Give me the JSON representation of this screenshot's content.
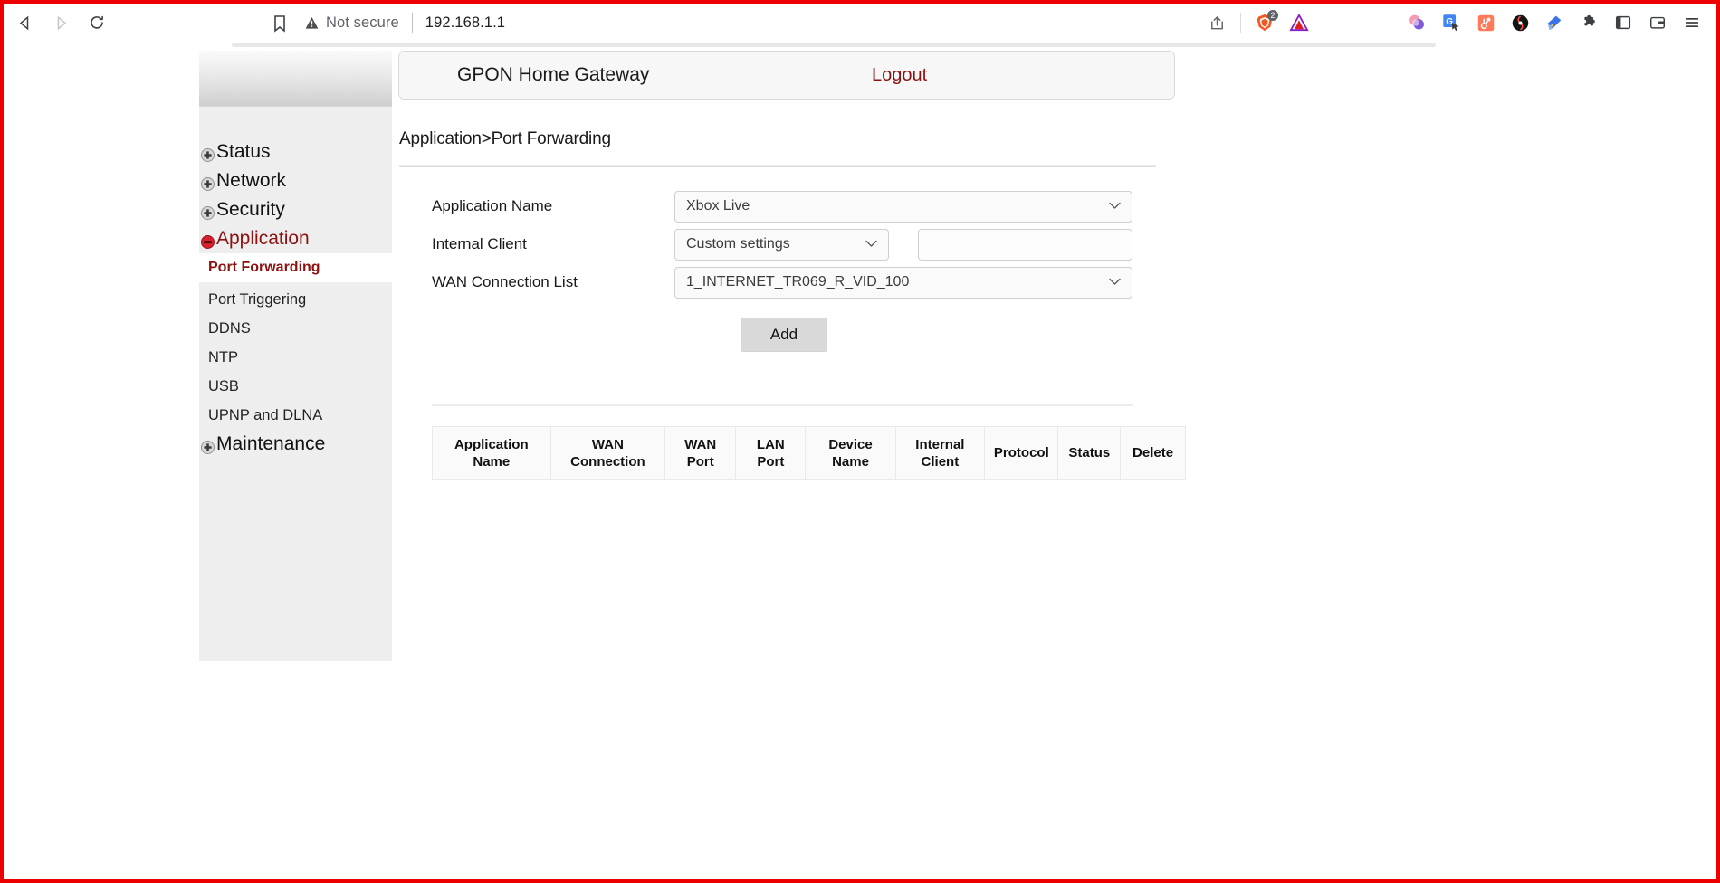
{
  "browser": {
    "back_icon": "back-arrow-icon",
    "forward_icon": "forward-arrow-icon",
    "reload_icon": "reload-icon",
    "bookmark_icon": "bookmark-icon",
    "security_warning_icon": "warning-triangle-icon",
    "security_label": "Not secure",
    "url": "192.168.1.1",
    "share_icon": "share-icon",
    "brave_badge": "2",
    "icons": [
      "share-icon",
      "brave-lion-icon",
      "adobe-triangle-icon",
      "color-blob-extension-icon",
      "google-translate-extension-icon",
      "hubspot-extension-icon",
      "kaspersky-extension-icon",
      "power-bi-extension-icon",
      "extensions-puzzle-icon",
      "sidebar-panel-icon",
      "wallet-icon",
      "browser-menu-icon"
    ]
  },
  "router": {
    "title": "GPON Home Gateway",
    "logout_label": "Logout",
    "breadcrumb": "Application>Port Forwarding",
    "accent_color": "#8c1212"
  },
  "sidebar": {
    "top_items": [
      {
        "label": "Status",
        "icon": "plus-expand-icon",
        "state": "collapsed",
        "active": false
      },
      {
        "label": "Network",
        "icon": "plus-expand-icon",
        "state": "collapsed",
        "active": false
      },
      {
        "label": "Security",
        "icon": "plus-expand-icon",
        "state": "collapsed",
        "active": false
      },
      {
        "label": "Application",
        "icon": "minus-collapse-icon",
        "state": "expanded",
        "active": true
      }
    ],
    "sub_items": [
      {
        "label": "Port Forwarding",
        "active": true
      },
      {
        "label": "Port Triggering",
        "active": false
      },
      {
        "label": "DDNS",
        "active": false
      },
      {
        "label": "NTP",
        "active": false
      },
      {
        "label": "USB",
        "active": false
      },
      {
        "label": "UPNP and DLNA",
        "active": false
      }
    ],
    "bottom_items": [
      {
        "label": "Maintenance",
        "icon": "plus-expand-icon",
        "state": "collapsed",
        "active": false
      }
    ]
  },
  "form": {
    "application_name": {
      "label": "Application Name",
      "value": "Xbox Live",
      "icon": "chevron-down-icon"
    },
    "internal_client": {
      "label": "Internal Client",
      "select_value": "Custom settings",
      "icon": "chevron-down-icon",
      "text_value": "",
      "text_placeholder": ""
    },
    "wan_connection_list": {
      "label": "WAN Connection List",
      "value": "1_INTERNET_TR069_R_VID_100",
      "icon": "chevron-down-icon"
    },
    "add_label": "Add"
  },
  "table": {
    "headers": [
      "Application Name",
      "WAN Connection",
      "WAN Port",
      "LAN Port",
      "Device Name",
      "Internal Client",
      "Protocol",
      "Status",
      "Delete"
    ],
    "rows": []
  }
}
